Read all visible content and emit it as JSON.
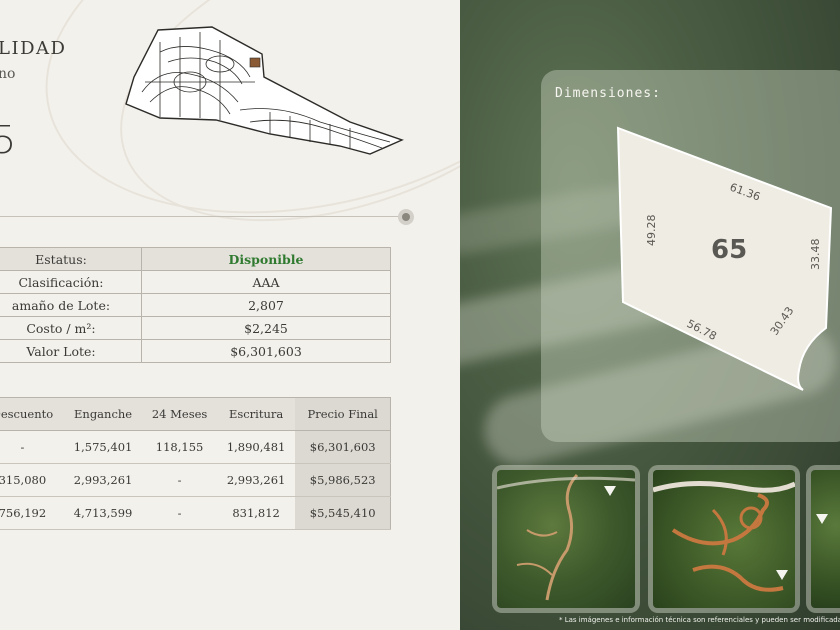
{
  "header": {
    "title": "LIDAD",
    "subtitle": "no",
    "lot_number": "5"
  },
  "info_table": [
    {
      "label": "Estatus:",
      "value": "Disponible"
    },
    {
      "label": "Clasificación:",
      "value": "AAA"
    },
    {
      "label": "amaño de Lote:",
      "value": "2,807"
    },
    {
      "label": "Costo / m²:",
      "value": "$2,245"
    },
    {
      "label": "Valor Lote:",
      "value": "$6,301,603"
    }
  ],
  "price_table": {
    "headers": [
      "Descuento",
      "Enganche",
      "24 Meses",
      "Escritura",
      "Precio Final"
    ],
    "rows": [
      [
        "-",
        "1,575,401",
        "118,155",
        "1,890,481",
        "$6,301,603"
      ],
      [
        "315,080",
        "2,993,261",
        "-",
        "2,993,261",
        "$5,986,523"
      ],
      [
        "756,192",
        "4,713,599",
        "-",
        "831,812",
        "$5,545,410"
      ]
    ]
  },
  "dimensions": {
    "label": "Dimensiones:",
    "lot_number": "65",
    "sides": [
      "61.36",
      "33.48",
      "30.43",
      "56.78",
      "49.28"
    ]
  },
  "footnote": "* Las imágenes e información técnica son referenciales y pueden ser modificadas",
  "colors": {
    "status_available": "#2f7a2f",
    "panel_bg": "#f3f1ec",
    "lot_fill": "#efece3"
  },
  "icons": {
    "slider": "slider-handle-icon",
    "thumbnail_expand": "expand-icon"
  }
}
